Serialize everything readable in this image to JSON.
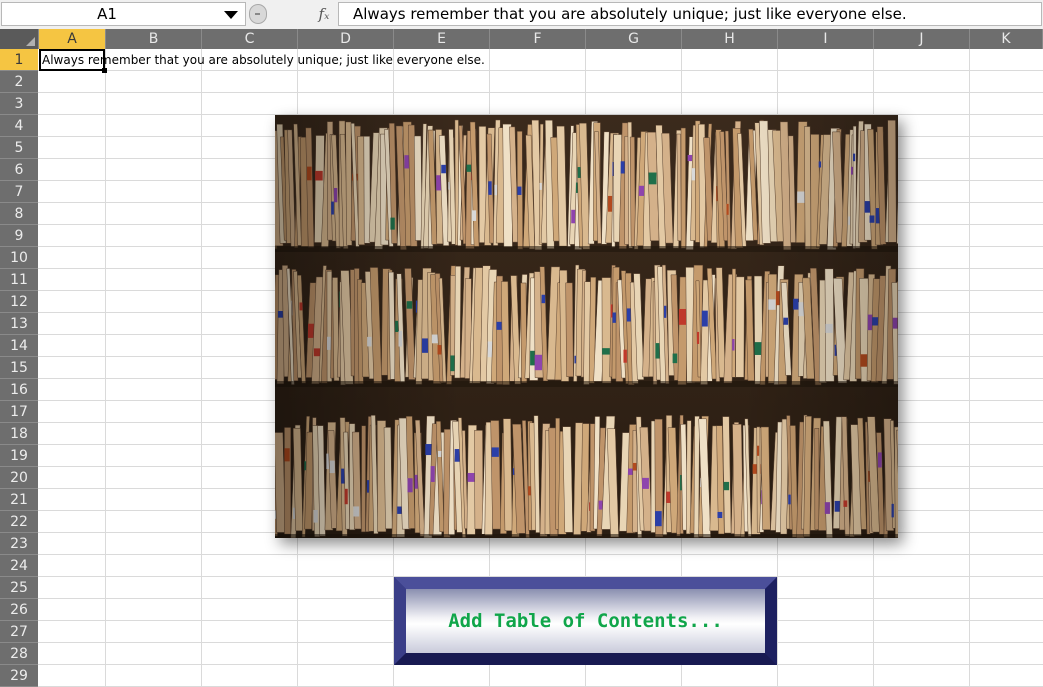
{
  "formula_bar": {
    "name_box": "A1",
    "fx_label": "fx",
    "formula": "Always remember that you are absolutely unique; just like everyone else."
  },
  "columns": [
    "A",
    "B",
    "C",
    "D",
    "E",
    "F",
    "G",
    "H",
    "I",
    "J",
    "K"
  ],
  "selected_column": "A",
  "rows": [
    "1",
    "2",
    "3",
    "4",
    "5",
    "6",
    "7",
    "8",
    "9",
    "10",
    "11",
    "12",
    "13",
    "14",
    "15",
    "16",
    "17",
    "18",
    "19",
    "20",
    "21",
    "22",
    "23",
    "24",
    "25",
    "26",
    "27",
    "28",
    "29"
  ],
  "selected_row": "1",
  "cells": {
    "A1": "Always remember that you are absolutely unique; just like everyone else."
  },
  "image": {
    "subject": "rows of paper file folders with colored tabs"
  },
  "button": {
    "label": "Add Table of Contents...",
    "text_color": "#10a64a"
  },
  "colors": {
    "header_bg": "#6e6e6e",
    "selected_header": "#f5c542",
    "button_frame": "#2a2e7a"
  }
}
